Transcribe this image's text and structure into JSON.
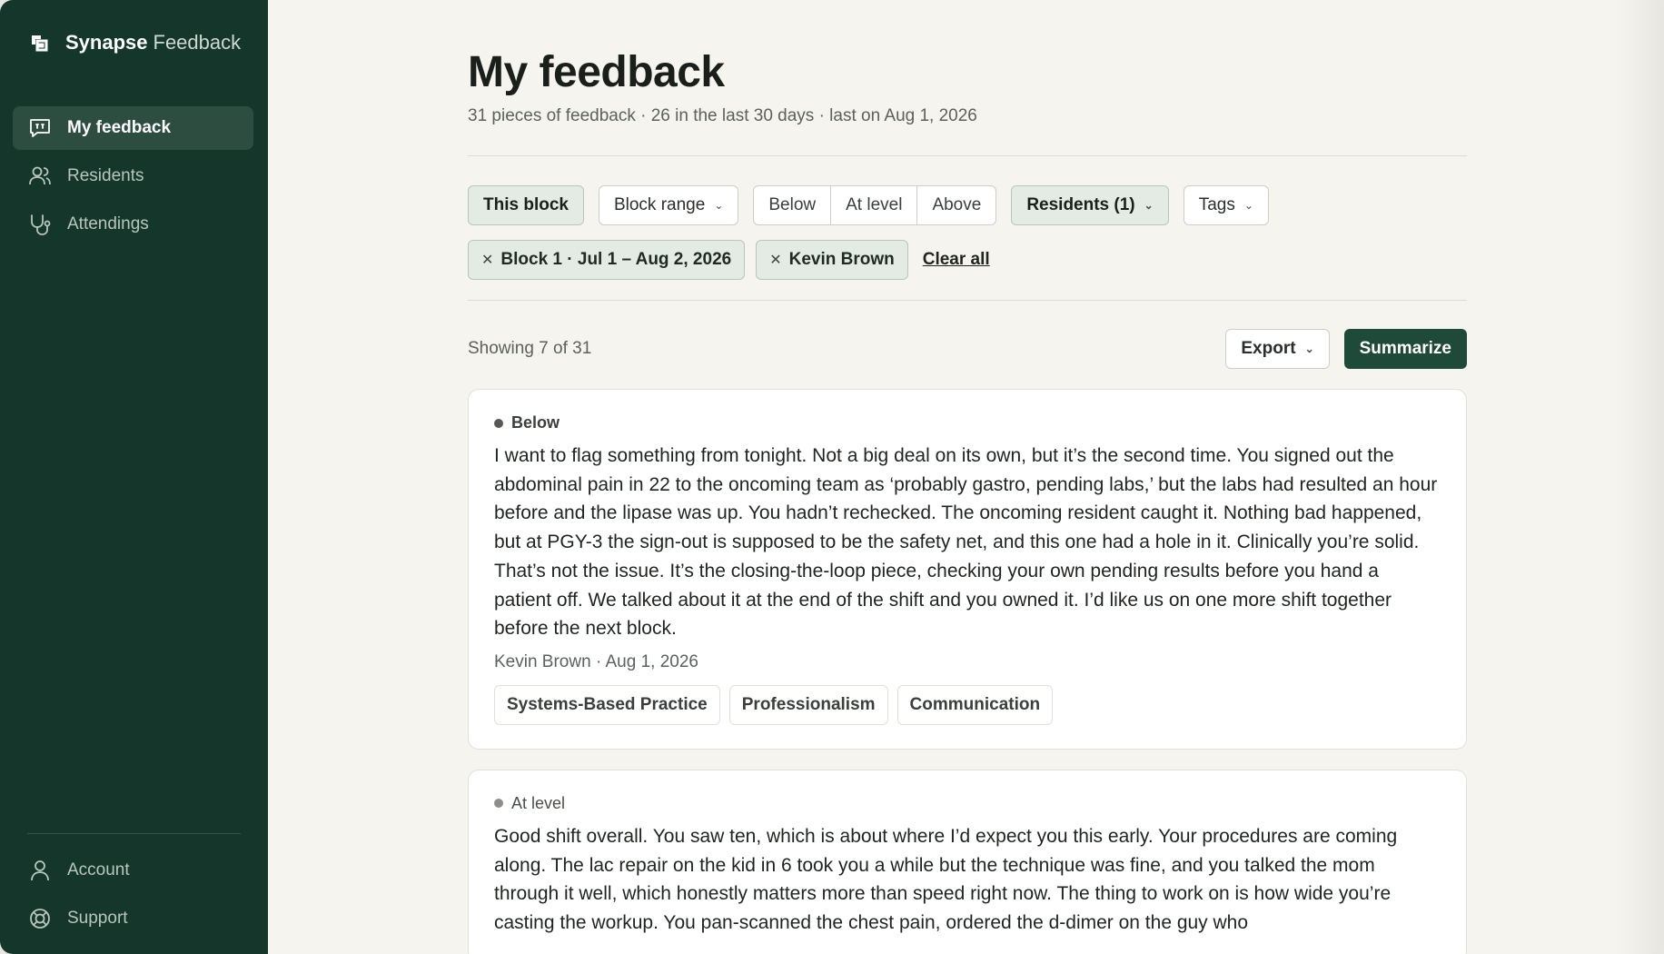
{
  "app": {
    "name": "Synapse",
    "name_suffix": "Feedback"
  },
  "sidebar": {
    "items": [
      {
        "label": "My feedback",
        "icon": "message-quote-icon",
        "active": true
      },
      {
        "label": "Residents",
        "icon": "users-icon",
        "active": false
      },
      {
        "label": "Attendings",
        "icon": "stethoscope-icon",
        "active": false
      }
    ],
    "bottom": [
      {
        "label": "Account",
        "icon": "user-icon"
      },
      {
        "label": "Support",
        "icon": "lifebuoy-icon"
      }
    ]
  },
  "header": {
    "title": "My feedback",
    "subtitle": "31 pieces of feedback · 26 in the last 30 days · last on Aug 1, 2026"
  },
  "filters": {
    "this_block": "This block",
    "block_range": "Block range",
    "levels": [
      "Below",
      "At level",
      "Above"
    ],
    "residents": "Residents (1)",
    "tags": "Tags"
  },
  "active_filters": {
    "block": "Block 1 · Jul 1 – Aug 2, 2026",
    "person": "Kevin Brown",
    "clear_all": "Clear all"
  },
  "toolbar": {
    "showing": "Showing 7 of 31",
    "export": "Export",
    "summarize": "Summarize"
  },
  "feedback": [
    {
      "level": "Below",
      "text": "I want to flag something from tonight. Not a big deal on its own, but it’s the second time. You signed out the abdominal pain in 22 to the oncoming team as ‘probably gastro, pending labs,’ but the labs had resulted an hour before and the lipase was up. You hadn’t rechecked. The oncoming resident caught it. Nothing bad happened, but at PGY-3 the sign-out is supposed to be the safety net, and this one had a hole in it. Clinically you’re solid. That’s not the issue. It’s the closing-the-loop piece, checking your own pending results before you hand a patient off. We talked about it at the end of the shift and you owned it. I’d like us on one more shift together before the next block.",
      "author_date": "Kevin Brown · Aug 1, 2026",
      "tags": [
        "Systems-Based Practice",
        "Professionalism",
        "Communication"
      ]
    },
    {
      "level": "At level",
      "text": "Good shift overall. You saw ten, which is about where I’d expect you this early. Your procedures are coming along. The lac repair on the kid in 6 took you a while but the technique was fine, and you talked the mom through it well, which honestly matters more than speed right now. The thing to work on is how wide you’re casting the workup. You pan-scanned the chest pain, ordered the d-dimer on the guy who"
    }
  ]
}
